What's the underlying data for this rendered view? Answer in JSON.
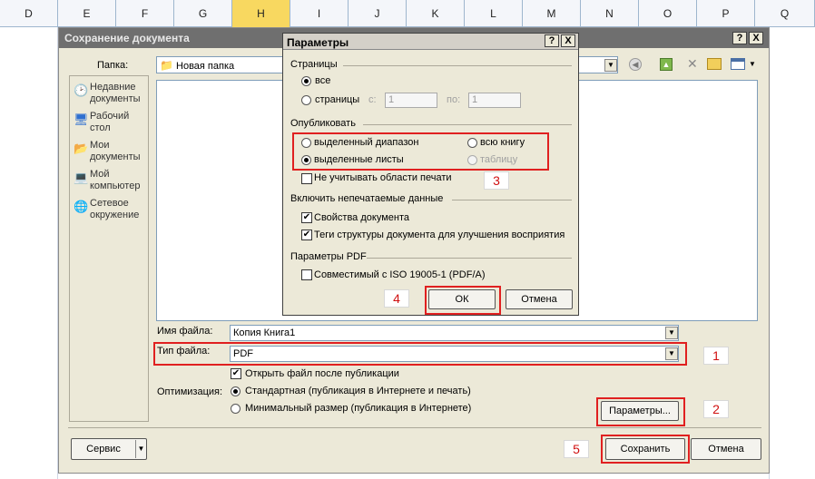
{
  "sheet": {
    "columns": [
      "D",
      "E",
      "F",
      "G",
      "H",
      "I",
      "J",
      "K",
      "L",
      "M",
      "N",
      "O",
      "P",
      "Q"
    ],
    "active_column": "H"
  },
  "save_dialog": {
    "title": "Сохранение документа",
    "help_btn": "?",
    "close_btn": "X",
    "folder_label": "Папка:",
    "folder_value": "Новая папка",
    "places": [
      {
        "label_l1": "Недавние",
        "label_l2": "документы",
        "icon": "recent-docs-icon"
      },
      {
        "label_l1": "Рабочий",
        "label_l2": "стол",
        "icon": "desktop-icon"
      },
      {
        "label_l1": "Мои",
        "label_l2": "документы",
        "icon": "my-documents-icon"
      },
      {
        "label_l1": "Мой",
        "label_l2": "компьютер",
        "icon": "my-computer-icon"
      },
      {
        "label_l1": "Сетевое",
        "label_l2": "окружение",
        "icon": "network-icon"
      }
    ],
    "filename_label": "Имя файла:",
    "filename_value": "Копия Книга1",
    "filetype_label": "Тип файла:",
    "filetype_value": "PDF",
    "open_after_label": "Открыть файл после публикации",
    "optimization_label": "Оптимизация:",
    "opt_standard_label": "Стандартная (публикация в Интернете и печать)",
    "opt_minimal_label": "Минимальный размер (публикация в Интернете)",
    "params_btn": "Параметры...",
    "service_btn": "Сервис",
    "save_btn": "Сохранить",
    "cancel_btn": "Отмена"
  },
  "params_dialog": {
    "title": "Параметры",
    "help_btn": "?",
    "close_btn": "X",
    "pages_group": "Страницы",
    "all_label": "все",
    "pages_label": "страницы",
    "from_label": "с:",
    "from_value": "1",
    "to_label": "по:",
    "to_value": "1",
    "publish_group": "Опубликовать",
    "selected_range": "выделенный диапазон",
    "whole_book": "всю книгу",
    "selected_sheets": "выделенные листы",
    "table": "таблицу",
    "ignore_print_area": "Не учитывать области печати",
    "nonprint_group": "Включить непечатаемые данные",
    "doc_properties": "Свойства документа",
    "struct_tags": "Теги структуры документа для улучшения восприятия",
    "pdf_group": "Параметры PDF",
    "iso_compat": "Совместимый с ISO 19005-1 (PDF/A)",
    "ok_btn": "ОК",
    "cancel_btn": "Отмена"
  },
  "callouts": {
    "c1": "1",
    "c2": "2",
    "c3": "3",
    "c4": "4",
    "c5": "5"
  },
  "colors": {
    "highlight": "#e02020",
    "callout_text": "#d01010",
    "active_column": "#f8d860"
  }
}
